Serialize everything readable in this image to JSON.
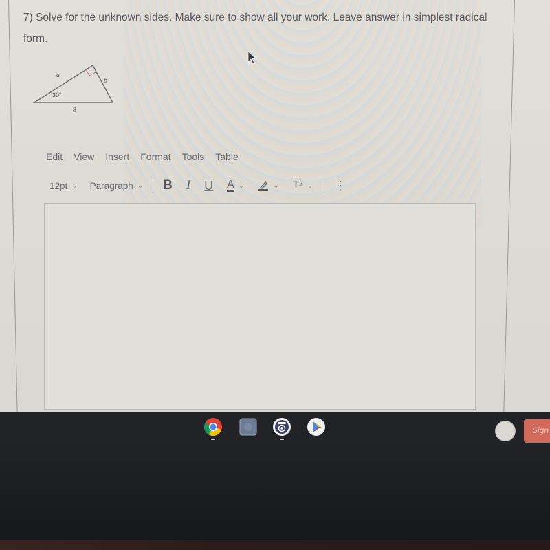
{
  "question": {
    "text": "7) Solve for the unknown sides.  Make sure to show all your work.  Leave answer in simplest radical form."
  },
  "diagram": {
    "label_a": "a",
    "label_b": "b",
    "angle_label": "30°",
    "hypotenuse_label": "8",
    "right_angle_color": "#c07070"
  },
  "editor": {
    "menu": [
      "Edit",
      "View",
      "Insert",
      "Format",
      "Tools",
      "Table"
    ],
    "font_size": "12pt",
    "block_format": "Paragraph",
    "buttons": {
      "bold": "B",
      "italic": "I",
      "underline": "U",
      "text_color": "A",
      "superscript": "T²",
      "more": "⋮"
    },
    "content": ""
  },
  "shelf": {
    "apps": [
      "chrome-icon",
      "files-icon",
      "camera-icon",
      "play-store-icon"
    ],
    "sign_button_label": "Sign",
    "sign_button_color": "#d26a5b"
  }
}
